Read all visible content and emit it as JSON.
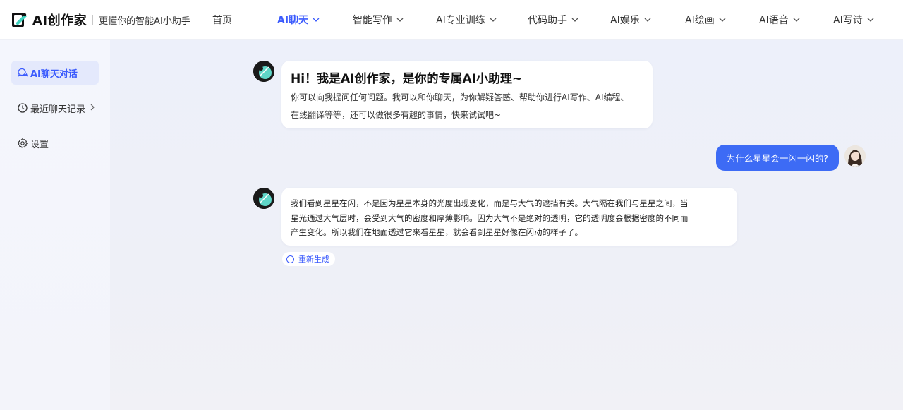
{
  "brand": {
    "name": "AI创作家",
    "slogan": "更懂你的智能AI小助手"
  },
  "nav": [
    {
      "label": "首页",
      "has_dropdown": false,
      "active": false
    },
    {
      "label": "AI聊天",
      "has_dropdown": true,
      "active": true
    },
    {
      "label": "智能写作",
      "has_dropdown": true,
      "active": false
    },
    {
      "label": "AI专业训练",
      "has_dropdown": true,
      "active": false
    },
    {
      "label": "代码助手",
      "has_dropdown": true,
      "active": false
    },
    {
      "label": "AI娱乐",
      "has_dropdown": true,
      "active": false
    },
    {
      "label": "AI绘画",
      "has_dropdown": true,
      "active": false
    },
    {
      "label": "AI语音",
      "has_dropdown": true,
      "active": false
    },
    {
      "label": "AI写诗",
      "has_dropdown": true,
      "active": false
    }
  ],
  "sidebar": {
    "items": [
      {
        "label": "AI聊天对话",
        "icon": "chat-bubbles-icon",
        "active": true
      },
      {
        "label": "最近聊天记录",
        "icon": "clock-icon",
        "active": false,
        "has_arrow": true
      },
      {
        "label": "设置",
        "icon": "gear-icon",
        "active": false
      }
    ]
  },
  "chat": {
    "welcome": {
      "title": "Hi！我是AI创作家，是你的专属AI小助理~",
      "lines": [
        "你可以向我提问任何问题。我可以和你聊天，为你解疑答惑、帮助你进行AI写作、AI编程、",
        "在线翻译等等，还可以做很多有趣的事情，快来试试吧~"
      ]
    },
    "user_message": "为什么星星会一闪一闪的?",
    "answer": {
      "lines": [
        "我们看到星星在闪，不是因为星星本身的光度出现变化，而是与大气的遮挡有关。大气隔在我们与星星之间，当",
        "星光通过大气层时，会受到大气的密度和厚薄影响。因为大气不是绝对的透明，它的透明度会根据密度的不同而",
        "产生变化。所以我们在地面透过它来看星星，就会看到星星好像在闪动的样子了。"
      ]
    },
    "regenerate_label": "重新生成"
  },
  "colors": {
    "accent": "#3b5bfd",
    "user_bubble": "#3d6bf5",
    "sidebar_active_bg": "#e4e9fc"
  }
}
